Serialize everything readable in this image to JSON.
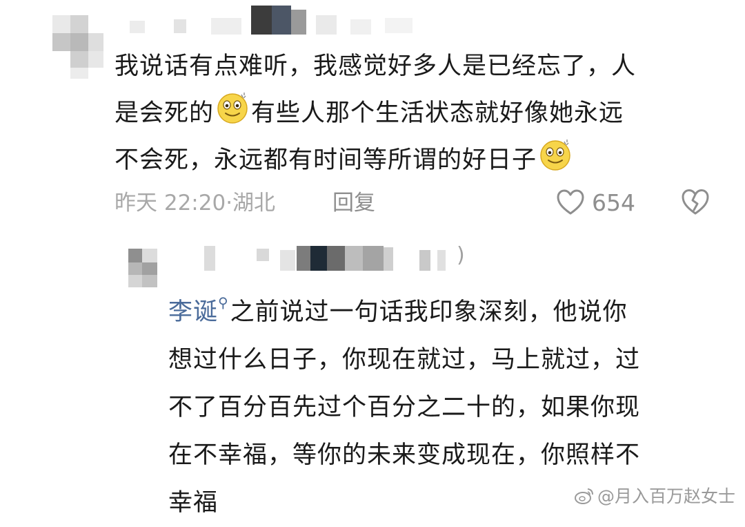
{
  "comment": {
    "lines": [
      "我说话有点难听，我感觉好多人是已经忘了，人",
      "是会死的",
      "有些人那个生活状态就好像她永远",
      "不会死，永远都有时间等所谓的好日子"
    ],
    "emoji_icon": "smiling-face-emoji",
    "time": "昨天 22:20·湖北",
    "reply_label": "回复",
    "like_count": "654",
    "like_icon": "heart-outline-icon",
    "dislike_icon": "broken-heart-icon"
  },
  "reply": {
    "mention": "李诞",
    "mention_suffix_icon": "search-icon",
    "first_line_rest": "之前说过一句话我印象深刻，他说你",
    "lines": [
      "想过什么日子，你现在就过，马上就过，过",
      "不了百分百先过个百分之二十的，如果你现",
      "在不幸福，等你的未来变成现在，你照样不",
      "幸福"
    ],
    "name_fragment": ")"
  },
  "watermark": {
    "text": "@月入百万赵女士",
    "icon": "weibo-logo-icon"
  },
  "colors": {
    "text": "#1a1a1a",
    "meta": "#a8a8a8",
    "action": "#8e8e8e",
    "mention": "#4a6b9a"
  }
}
